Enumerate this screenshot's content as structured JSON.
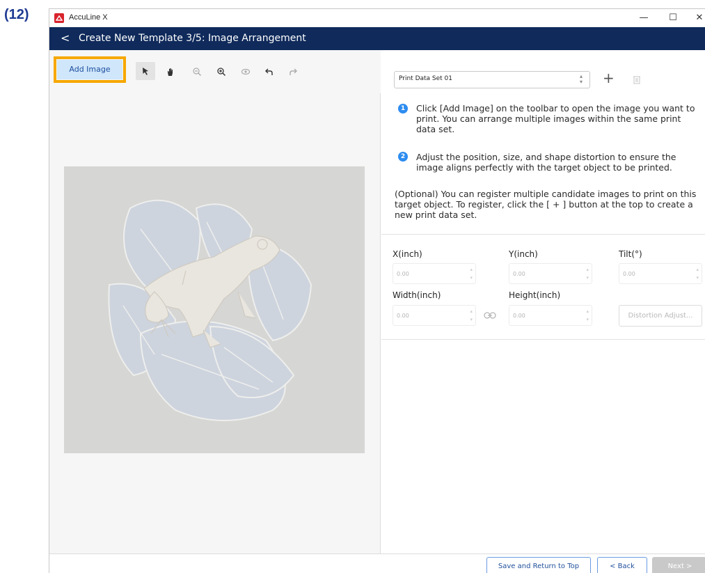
{
  "step_label": "(12)",
  "window": {
    "app_title": "AccuLine X",
    "controls": {
      "minimize": "—",
      "maximize": "☐",
      "close": "✕"
    }
  },
  "header": {
    "back": "<",
    "title": "Create New Template 3/5: Image Arrangement"
  },
  "toolbar": {
    "add_image_label": "Add Image",
    "tools": [
      "select-arrow",
      "hand-pan",
      "zoom-out",
      "zoom-in",
      "preview-eye",
      "undo",
      "redo"
    ]
  },
  "dataset": {
    "selected": "Print Data Set 01",
    "add_label": "+"
  },
  "instructions": {
    "step1_num": "1",
    "step1": "Click [Add Image] on the toolbar to open the image you want to print. You can arrange multiple images within the same print data set.",
    "step2_num": "2",
    "step2": "Adjust the position, size, and shape distortion to ensure the image aligns perfectly with the target object to be printed.",
    "optional": "(Optional) You can register multiple candidate images to print on this target object. To register, click the [ + ] button at the top to create a new print data set."
  },
  "fields": {
    "x_label": "X(inch)",
    "x_value": "0.00",
    "y_label": "Y(inch)",
    "y_value": "0.00",
    "tilt_label": "Tilt(°)",
    "tilt_value": "0.00",
    "width_label": "Width(inch)",
    "width_value": "0.00",
    "height_label": "Height(inch)",
    "height_value": "0.00",
    "distortion_label": "Distortion Adjust..."
  },
  "footer": {
    "save_label": "Save and Return to Top",
    "back_label": "< Back",
    "next_label": "Next >"
  },
  "colors": {
    "header_bg": "#0f2a5b",
    "highlight": "#f6a800",
    "add_image_bg": "#cfe6fb",
    "badge": "#2d8cf0",
    "app_logo": "#d9232d"
  }
}
